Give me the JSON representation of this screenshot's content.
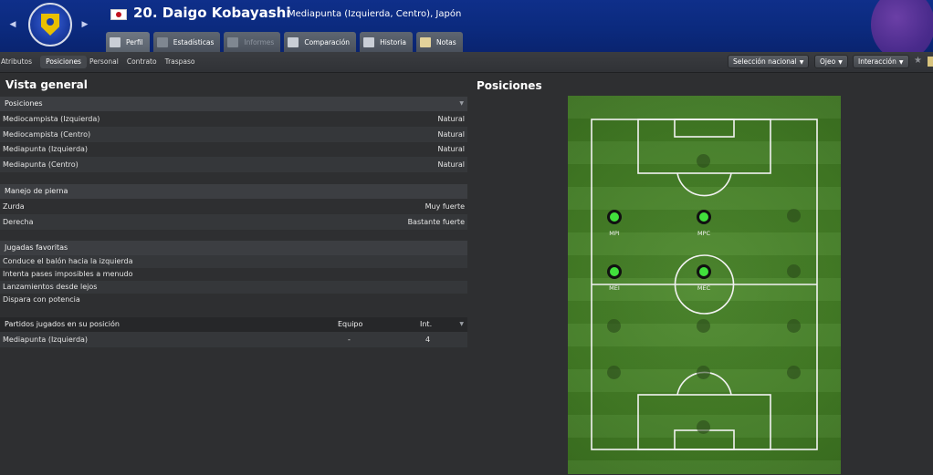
{
  "header": {
    "number_name": "20. Daigo Kobayashi",
    "position_nation": "Mediapunta (Izquierda, Centro), Japón",
    "tabs": [
      {
        "label": "Perfil"
      },
      {
        "label": "Estadísticas"
      },
      {
        "label": "Informes"
      },
      {
        "label": "Comparación"
      },
      {
        "label": "Historia"
      },
      {
        "label": "Notas"
      }
    ]
  },
  "subnav": {
    "items": [
      "Atributos",
      "Posiciones",
      "Personal",
      "Contrato",
      "Traspaso"
    ],
    "dropdowns": [
      "Selección nacional",
      "Ojeo",
      "Interacción"
    ]
  },
  "overview": {
    "title": "Vista general",
    "positions_header": "Posiciones",
    "positions": [
      {
        "name": "Mediocampista (Izquierda)",
        "value": "Natural"
      },
      {
        "name": "Mediocampista (Centro)",
        "value": "Natural"
      },
      {
        "name": "Mediapunta (Izquierda)",
        "value": "Natural"
      },
      {
        "name": "Mediapunta (Centro)",
        "value": "Natural"
      }
    ],
    "foot_header": "Manejo de pierna",
    "feet": [
      {
        "name": "Zurda",
        "value": "Muy fuerte"
      },
      {
        "name": "Derecha",
        "value": "Bastante fuerte"
      }
    ],
    "moves_header": "Jugadas favoritas",
    "moves": [
      "Conduce el balón hacia la izquierda",
      "Intenta pases imposibles a menudo",
      "Lanzamientos desde lejos",
      "Dispara con potencia"
    ],
    "matches_header": "Partidos jugados en su posición",
    "matches_col_team": "Equipo",
    "matches_col_int": "Int.",
    "matches": [
      {
        "position": "Mediapunta (Izquierda)",
        "team": "-",
        "int": "4"
      }
    ]
  },
  "pitch_panel": {
    "title": "Posiciones",
    "positions": [
      {
        "label": "MPI"
      },
      {
        "label": "MPC"
      },
      {
        "label": "MEI"
      },
      {
        "label": "MEC"
      }
    ]
  }
}
